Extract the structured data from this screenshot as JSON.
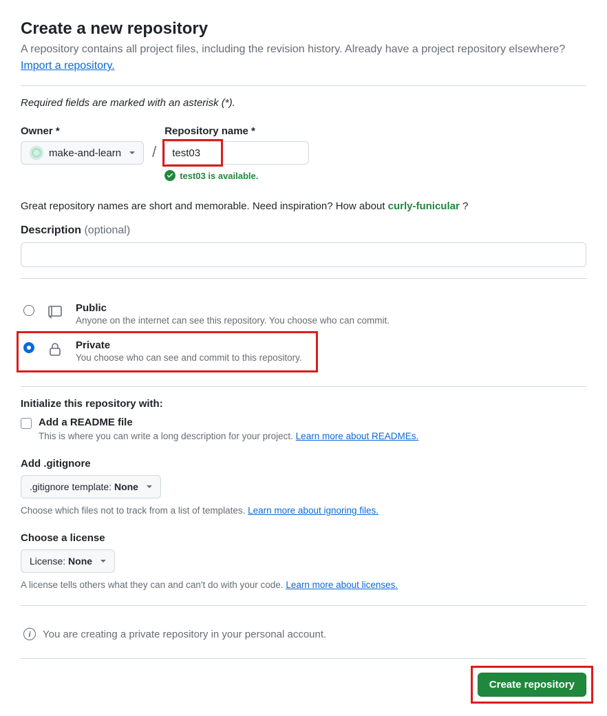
{
  "header": {
    "title": "Create a new repository",
    "subtitle": "A repository contains all project files, including the revision history. Already have a project repository elsewhere?",
    "import_link": "Import a repository."
  },
  "required_note": "Required fields are marked with an asterisk (*).",
  "owner": {
    "label": "Owner *",
    "value": "make-and-learn"
  },
  "repo_name": {
    "label": "Repository name *",
    "value": "test03",
    "available_msg": "test03 is available."
  },
  "inspiration": {
    "prefix": "Great repository names are short and memorable. Need inspiration? How about ",
    "suggestion": "curly-funicular",
    "suffix": " ?"
  },
  "description": {
    "label": "Description",
    "optional": "(optional)",
    "value": ""
  },
  "visibility": {
    "public": {
      "title": "Public",
      "desc": "Anyone on the internet can see this repository. You choose who can commit."
    },
    "private": {
      "title": "Private",
      "desc": "You choose who can see and commit to this repository."
    },
    "selected": "private"
  },
  "initialize": {
    "heading": "Initialize this repository with:",
    "readme": {
      "title": "Add a README file",
      "desc_prefix": "This is where you can write a long description for your project. ",
      "link": "Learn more about READMEs."
    }
  },
  "gitignore": {
    "heading": "Add .gitignore",
    "button_prefix": ".gitignore template: ",
    "button_value": "None",
    "help_prefix": "Choose which files not to track from a list of templates. ",
    "help_link": "Learn more about ignoring files."
  },
  "license": {
    "heading": "Choose a license",
    "button_prefix": "License: ",
    "button_value": "None",
    "help_prefix": "A license tells others what they can and can't do with your code. ",
    "help_link": "Learn more about licenses."
  },
  "info_msg": "You are creating a private repository in your personal account.",
  "submit": "Create repository"
}
